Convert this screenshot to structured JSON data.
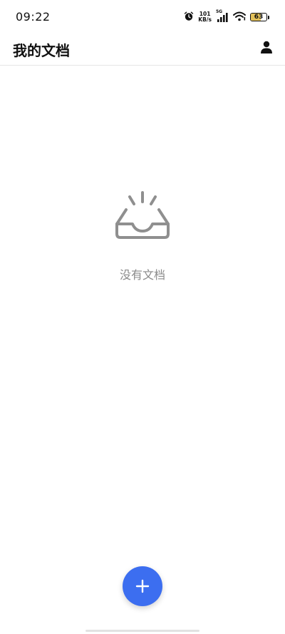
{
  "status_bar": {
    "time": "09:22",
    "net_speed_value": "101",
    "net_speed_unit": "KB/s",
    "network_type": "5G",
    "battery_level": "63",
    "battery_fraction": 0.63,
    "icons": [
      "alarm-icon",
      "signal-icon",
      "wifi-icon",
      "battery-icon"
    ]
  },
  "app_bar": {
    "title": "我的文档",
    "account_icon": "person-icon"
  },
  "empty_state": {
    "icon": "empty-inbox-icon",
    "message": "没有文档"
  },
  "fab": {
    "icon": "plus-icon",
    "color": "#3c6ef0"
  },
  "colors": {
    "accent": "#3c6ef0",
    "empty_text": "#8a8a8a",
    "battery_fill": "#e3c15a"
  }
}
